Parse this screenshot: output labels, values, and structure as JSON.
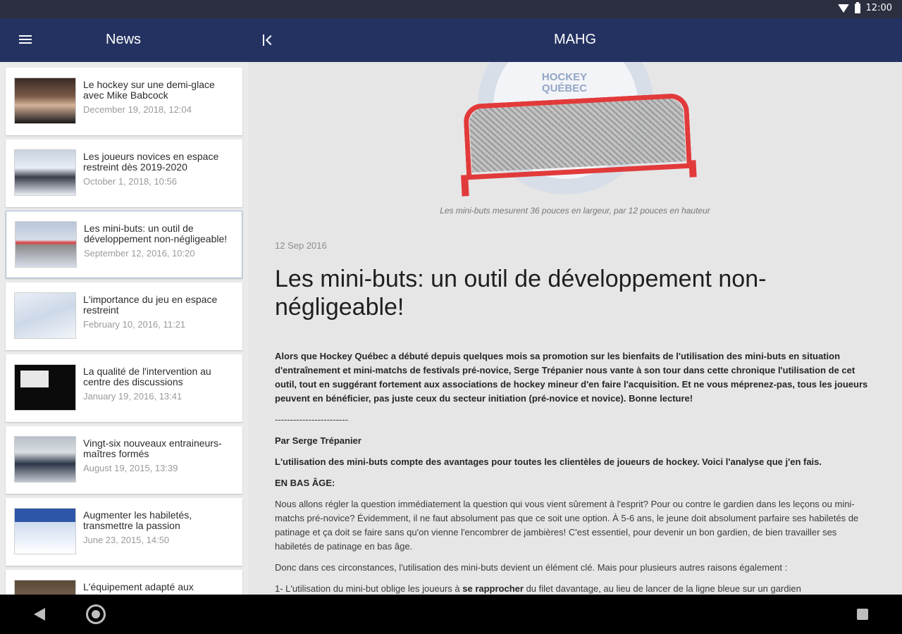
{
  "status_bar": {
    "time": "12:00"
  },
  "app_bar": {
    "title": "News",
    "detail_title": "MAHG"
  },
  "news": [
    {
      "title": "Le hockey sur une demi-glace avec Mike Babcock",
      "date": "December 19, 2018, 12:04"
    },
    {
      "title": "Les joueurs novices en espace restreint dès 2019-2020",
      "date": "October 1, 2018, 10:56"
    },
    {
      "title": "Les mini-buts: un outil de développement non-négligeable!",
      "date": "September 12, 2016, 10:20"
    },
    {
      "title": "L'importance du jeu en espace restreint",
      "date": "February 10, 2016, 11:21"
    },
    {
      "title": "La qualité de l'intervention au centre des discussions",
      "date": "January 19, 2016, 13:41"
    },
    {
      "title": "Vingt-six nouveaux entraineurs-maîtres formés",
      "date": "August 19, 2015, 13:39"
    },
    {
      "title": "Augmenter les habiletés, transmettre la passion",
      "date": "June 23, 2015, 14:50"
    },
    {
      "title": "L'équipement adapté aux",
      "date": ""
    }
  ],
  "hero": {
    "logo_text": "HOCKEY QUÉBEC",
    "caption": "Les mini-buts mesurent 36 pouces en largeur, par 12 pouces en hauteur"
  },
  "article": {
    "date": "12 Sep 2016",
    "title": "Les mini-buts: un outil de développement non-négligeable!",
    "intro": "Alors que Hockey Québec a débuté depuis quelques mois sa promotion sur les bienfaits de l'utilisation des mini-buts en situation d'entraînement et mini-matchs de festivals pré-novice, Serge Trépanier nous vante à son tour dans cette chronique l'utilisation de cet outil, tout en suggérant fortement aux associations de hockey mineur d'en faire l'acquisition. Et ne vous méprenez-pas, tous les joueurs peuvent en bénéficier, pas juste ceux du secteur initiation (pré-novice et novice). Bonne lecture!",
    "divider": "------------------------",
    "author": "Par Serge Trépanier",
    "lead": "L'utilisation des mini-buts compte des avantages pour toutes les clientèles de joueurs de hockey. Voici l'analyse que j'en fais.",
    "section": "EN BAS ÂGE:",
    "p1": "Nous allons régler la question immédiatement la question qui vous vient sûrement à l'esprit? Pour ou contre le gardien dans les leçons ou mini-matchs pré-novice? Évidemment, il ne faut absolument pas que ce soit une option. À 5-6 ans, le jeune doit absolument parfaire ses habiletés de patinage et ça doit se faire sans qu'on vienne l'encombrer de jambières! C'est essentiel, pour devenir un bon gardien, de bien travailler ses habiletés de patinage en bas âge.",
    "p2": "Donc dans ces circonstances, l'utilisation des mini-buts devient un élément clé.  Mais pour plusieurs autres raisons également :",
    "p3_start": "1- L'utilisation du mini-but oblige les joueurs à ",
    "p3_bold": "se rapprocher",
    "p3_end": " du filet davantage, au lieu de lancer de la ligne bleue sur un gardien"
  }
}
